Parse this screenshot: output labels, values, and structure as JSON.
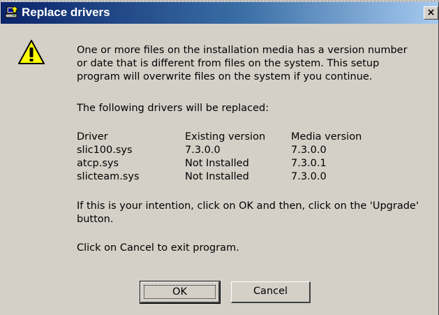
{
  "window": {
    "title": "Replace drivers",
    "close_glyph": "×"
  },
  "message": {
    "line1": "One or more files on the installation media has a version number",
    "line2": "or date that is different from files on the system.  This setup",
    "line3": "program will overwrite files on the system if you continue.",
    "intro": "The following drivers will be replaced:"
  },
  "drivers": {
    "headers": [
      "Driver",
      "Existing version",
      "Media version"
    ],
    "rows": [
      [
        "slic100.sys",
        "7.3.0.0",
        "7.3.0.0"
      ],
      [
        "atcp.sys",
        "Not Installed",
        "7.3.0.1"
      ],
      [
        "slicteam.sys",
        "Not Installed",
        "7.3.0.0"
      ]
    ]
  },
  "instructions": {
    "line1": "If this is your intention, click on OK and then, click on the 'Upgrade'",
    "line2": "button.",
    "cancel_hint": "Click on Cancel to exit program."
  },
  "buttons": {
    "ok": "OK",
    "cancel": "Cancel"
  },
  "icons": {
    "title": "setup-computer-icon",
    "warning": "warning-icon",
    "close": "close-icon"
  },
  "colors": {
    "titlebar_start": "#0a246a",
    "titlebar_end": "#a6caf0",
    "dialog_bg": "#d4d0c8",
    "warning_yellow": "#ffff00"
  }
}
